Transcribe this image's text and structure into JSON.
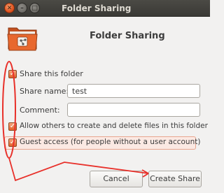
{
  "window": {
    "title": "Folder Sharing",
    "close_glyph": "✕",
    "min_glyph": "–",
    "max_glyph": "□"
  },
  "header": {
    "icon": "shared-folder-icon",
    "title": "Folder Sharing"
  },
  "options": {
    "share_folder": {
      "label": "Share this folder",
      "checked": true
    },
    "share_name": {
      "label": "Share name:",
      "value": "test"
    },
    "comment": {
      "label": "Comment:",
      "value": ""
    },
    "allow_others": {
      "label": "Allow others to create and delete files in this folder",
      "checked": true
    },
    "guest_access": {
      "label": "Guest access (for people without a user account)",
      "checked": true
    }
  },
  "buttons": {
    "cancel": "Cancel",
    "create_share": "Create Share"
  },
  "check_glyph": "✓",
  "colors": {
    "accent": "#e0622b",
    "annotation_red": "#e8302a",
    "titlebar": "#3c3b37"
  }
}
